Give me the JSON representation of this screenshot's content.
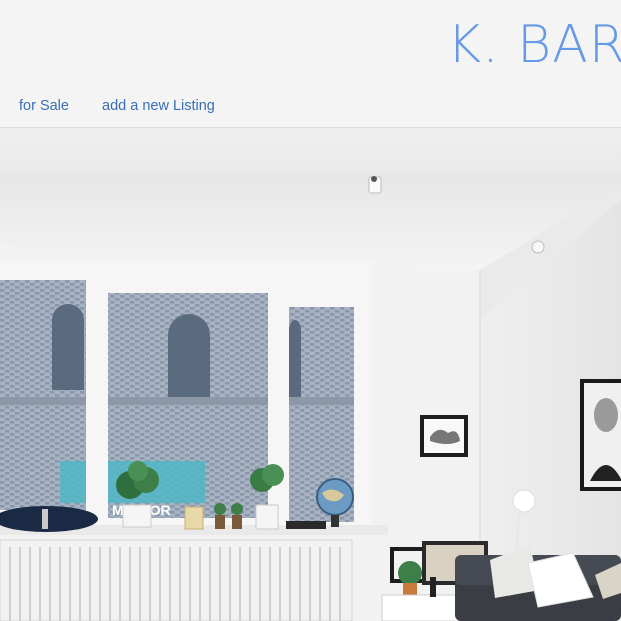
{
  "brand": {
    "title": "K. BARB"
  },
  "nav": {
    "items": [
      {
        "label": "for Sale"
      },
      {
        "label": "add a new Listing"
      }
    ]
  },
  "hero": {
    "image": "living-room-photo",
    "sign_text": "MATTOR"
  },
  "colors": {
    "brand": "#6699e6",
    "nav_link": "#3a6fb5",
    "header_bg": "#f4f4f4"
  }
}
